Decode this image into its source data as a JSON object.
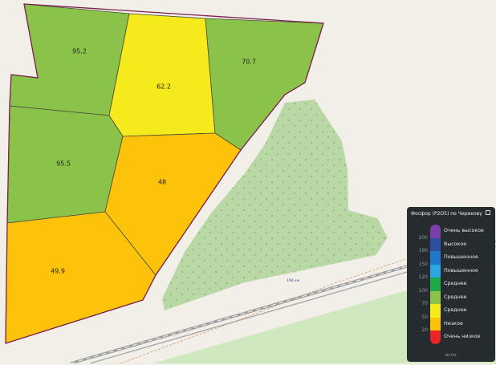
{
  "map": {
    "fields": [
      {
        "id": "f1",
        "value": "95.2",
        "color": "#8bc34a"
      },
      {
        "id": "f2",
        "value": "62.2",
        "color": "#f5ea1b"
      },
      {
        "id": "f3",
        "value": "70.7",
        "color": "#8bc34a"
      },
      {
        "id": "f4",
        "value": "95.5",
        "color": "#8bc34a"
      },
      {
        "id": "f5",
        "value": "48",
        "color": "#fdc30b"
      },
      {
        "id": "f6",
        "value": "49.9",
        "color": "#fdc30b"
      }
    ],
    "field_border_color": "#7a1f4a",
    "forest_color": "#b9d8a6",
    "road_label": "194 км"
  },
  "legend": {
    "title": "Фосфор (P2O5) по Чирикову",
    "unit": "мг/кг",
    "ticks": [
      "200",
      "180",
      "150",
      "120",
      "100",
      "70",
      "50",
      "20"
    ],
    "classes": [
      {
        "label": "Очень высокое",
        "color": "#7b3fa8"
      },
      {
        "label": "Высокое",
        "color": "#2c4fa0"
      },
      {
        "label": "Повышенное",
        "color": "#1f78c8"
      },
      {
        "label": "Повышенное",
        "color": "#2aa6e0"
      },
      {
        "label": "Среднее",
        "color": "#1fa84a"
      },
      {
        "label": "Среднее",
        "color": "#8bc34a"
      },
      {
        "label": "Среднее",
        "color": "#f5ea1b"
      },
      {
        "label": "Низкое",
        "color": "#fdc30b"
      },
      {
        "label": "Очень низкое",
        "color": "#e8262a"
      }
    ]
  }
}
